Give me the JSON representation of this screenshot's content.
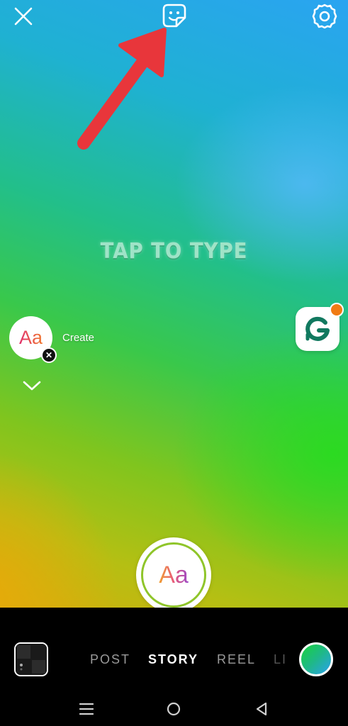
{
  "canvas": {
    "prompt": "TAP TO TYPE",
    "colors": {
      "gradient_top": "#2aa4f1",
      "gradient_mid": "#39c84b",
      "gradient_bottom": "#d1b00c"
    }
  },
  "top_bar": {
    "close_icon": "close-icon",
    "sticker_icon": "sticker-icon",
    "settings_icon": "settings-icon"
  },
  "annotation": {
    "arrow_color": "#e8363b",
    "points_to": "sticker-icon"
  },
  "left_tools": {
    "create": {
      "icon_text": "Aa",
      "label": "Create"
    },
    "collapse_icon": "chevron-down-icon"
  },
  "right_sticker": {
    "letter": "G",
    "badge_color": "#f07b14"
  },
  "capture": {
    "label": "Aa"
  },
  "modes": {
    "items": [
      {
        "label": "POST"
      },
      {
        "label": "STORY"
      },
      {
        "label": "REEL"
      },
      {
        "label": "LI"
      }
    ],
    "active": "STORY"
  },
  "bottom": {
    "gallery_icon": "gallery-thumbnail",
    "color_picker_icon": "color-gradient-icon"
  },
  "system_nav": {
    "recents_icon": "menu-icon",
    "home_icon": "home-icon",
    "back_icon": "back-icon"
  }
}
